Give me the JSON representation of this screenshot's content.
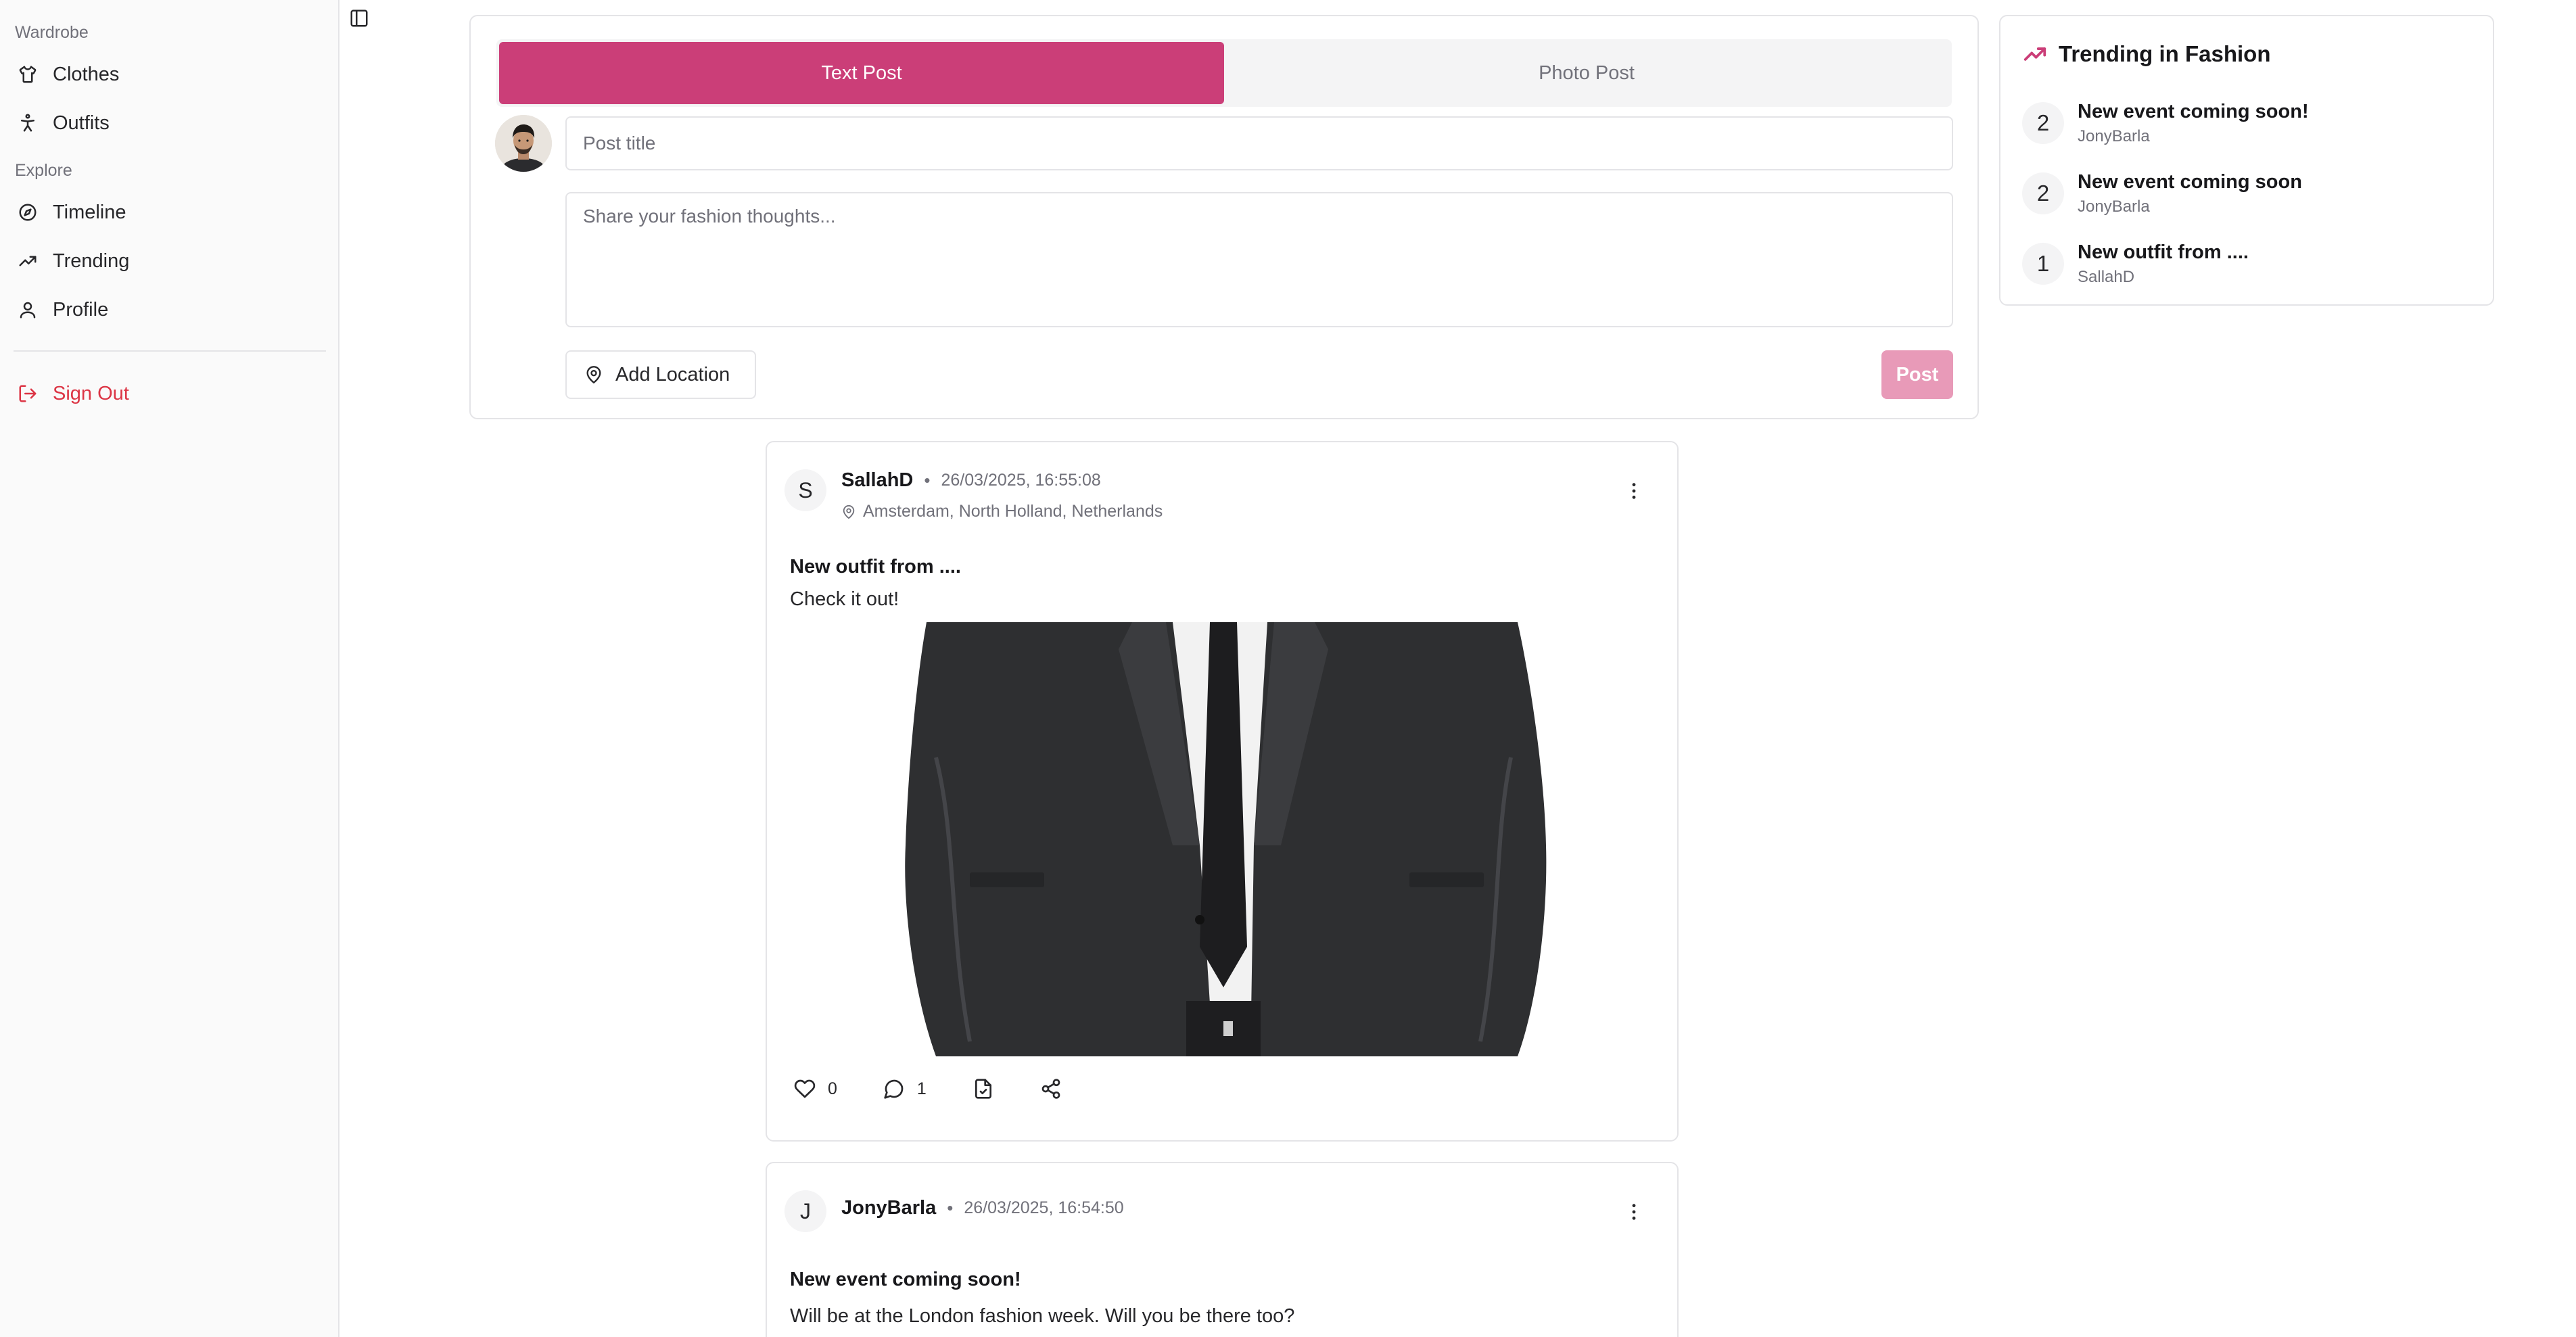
{
  "sidebar": {
    "sections": [
      {
        "label": "Wardrobe",
        "items": [
          {
            "label": "Clothes",
            "icon": "shirt-icon"
          },
          {
            "label": "Outfits",
            "icon": "person-icon"
          }
        ]
      },
      {
        "label": "Explore",
        "items": [
          {
            "label": "Timeline",
            "icon": "compass-icon"
          },
          {
            "label": "Trending",
            "icon": "trending-icon"
          },
          {
            "label": "Profile",
            "icon": "user-icon"
          }
        ]
      }
    ],
    "sign_out": "Sign Out"
  },
  "composer": {
    "tabs": [
      {
        "label": "Text Post",
        "active": true
      },
      {
        "label": "Photo Post",
        "active": false
      }
    ],
    "title_placeholder": "Post title",
    "body_placeholder": "Share your fashion thoughts...",
    "location_button": "Add Location",
    "post_button": "Post"
  },
  "trending": {
    "title": "Trending in Fashion",
    "items": [
      {
        "rank": "2",
        "title": "New event coming soon!",
        "author": "JonyBarla"
      },
      {
        "rank": "2",
        "title": "New event coming soon",
        "author": "JonyBarla"
      },
      {
        "rank": "1",
        "title": "New outfit from ....",
        "author": "SallahD"
      }
    ]
  },
  "posts": [
    {
      "initial": "S",
      "author": "SallahD",
      "separator": "•",
      "timestamp": "26/03/2025, 16:55:08",
      "location": "Amsterdam, North Holland, Netherlands",
      "title": "New outfit from ....",
      "body": "Check it out!",
      "likes": "0",
      "comments": "1"
    },
    {
      "initial": "J",
      "author": "JonyBarla",
      "separator": "•",
      "timestamp": "26/03/2025, 16:54:50",
      "title": "New event coming soon!",
      "body": "Will be at the London fashion week. Will you be there too?"
    }
  ],
  "colors": {
    "accent": "#cb3e78",
    "accent_disabled": "#e89ab8",
    "danger": "#dc3545",
    "border": "#e4e4e7",
    "muted": "#71717a"
  }
}
